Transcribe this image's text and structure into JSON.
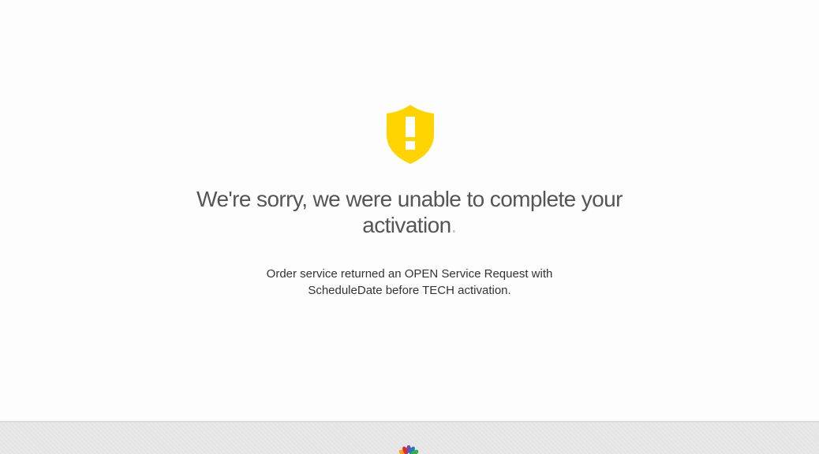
{
  "error": {
    "headline_main": "We're sorry, we were unable to complete your activation",
    "headline_end": ".",
    "detail_line1": "Order service returned an OPEN Service Request with",
    "detail_line2": "ScheduleDate before TECH activation."
  },
  "icons": {
    "warning": "shield-warning-icon",
    "logo": "peacock-logo-icon"
  },
  "colors": {
    "shield": "#FFD400",
    "background": "#FDFDFD",
    "footer": "#E8E8E8"
  }
}
